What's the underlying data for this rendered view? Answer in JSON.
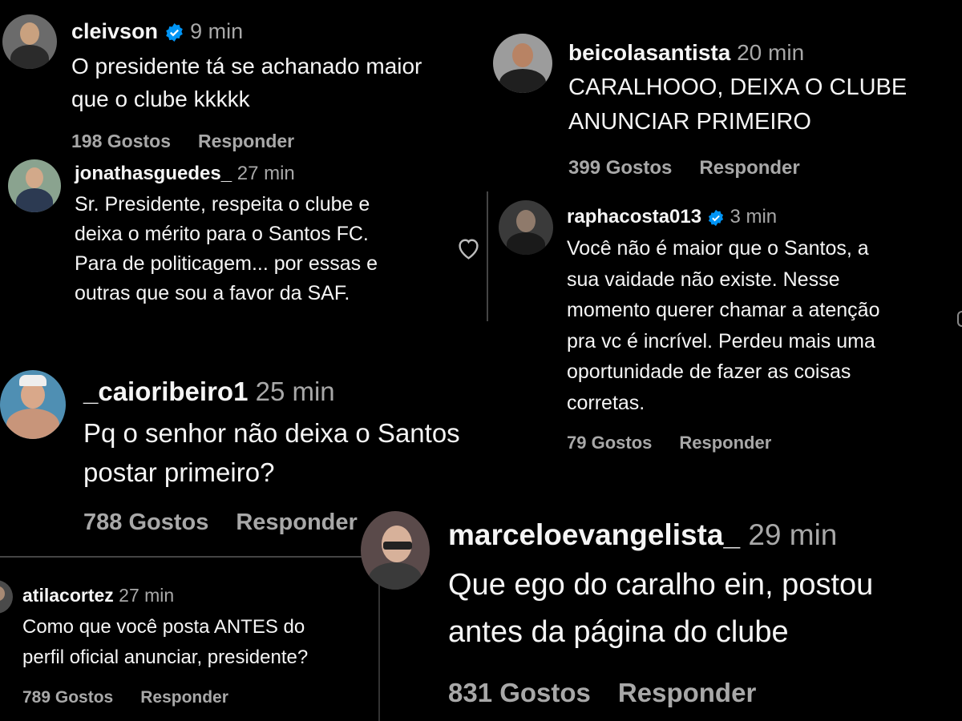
{
  "comments": [
    {
      "username": "cleivson",
      "verified": true,
      "time": "9 min",
      "text_lines": [
        "O presidente tá se achanado maior",
        "que o clube kkkkk"
      ],
      "likes": "198 Gostos",
      "reply": "Responder"
    },
    {
      "username": "jonathasguedes_",
      "verified": false,
      "time": "27 min",
      "text_lines": [
        "Sr. Presidente, respeita o clube e",
        "deixa o mérito para o Santos FC.",
        "Para de politicagem... por essas e",
        "outras que sou a favor da SAF."
      ],
      "likes": "",
      "reply": ""
    },
    {
      "username": "beicolasantista",
      "verified": false,
      "time": "20 min",
      "text_lines": [
        "CARALHOOO, DEIXA O CLUBE",
        "ANUNCIAR PRIMEIRO"
      ],
      "likes": "399 Gostos",
      "reply": "Responder"
    },
    {
      "username": "raphacosta013",
      "verified": true,
      "time": "3 min",
      "text_lines": [
        "Você não é maior que o Santos, a",
        "sua vaidade não existe. Nesse",
        "momento querer chamar a atenção",
        "pra vc é incrível. Perdeu mais uma",
        "oportunidade de fazer as coisas",
        "corretas."
      ],
      "likes": "79 Gostos",
      "reply": "Responder"
    },
    {
      "username": "_caioribeiro1",
      "verified": false,
      "time": "25 min",
      "text_lines": [
        "Pq o senhor não deixa o Santos",
        "postar primeiro?"
      ],
      "likes": "788 Gostos",
      "reply": "Responder"
    },
    {
      "username": "atilacortez",
      "verified": false,
      "time": "27 min",
      "text_lines": [
        "Como que você posta ANTES do",
        "perfil oficial anunciar, presidente?"
      ],
      "likes": "789 Gostos",
      "reply": "Responder"
    },
    {
      "username": "marceloevangelista_",
      "verified": false,
      "time": "29 min",
      "text_lines": [
        "Que ego do caralho ein, postou",
        "antes da página do clube"
      ],
      "likes": "831 Gostos",
      "reply": "Responder"
    }
  ],
  "icons": {
    "verified": "verified-badge-icon",
    "like": "heart-outline-icon"
  },
  "colors": {
    "background": "#000000",
    "text": "#f5f5f5",
    "muted": "#a8a8a8",
    "verified": "#0095f6"
  }
}
